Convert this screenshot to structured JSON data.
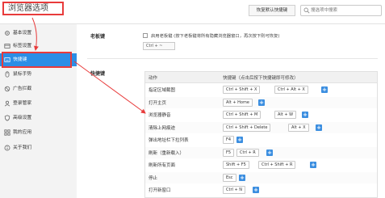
{
  "header": {
    "title": "浏览器选项",
    "restore_label": "恢复默认快捷键",
    "search_placeholder": "搜选项中搜索"
  },
  "sidebar": {
    "items": [
      {
        "label": "基本设置",
        "icon": "gear-icon"
      },
      {
        "label": "标签设置",
        "icon": "tab-icon"
      },
      {
        "label": "快捷键",
        "icon": "keyboard-icon",
        "active": true
      },
      {
        "label": "鼠标手势",
        "icon": "mouse-icon"
      },
      {
        "label": "广告拦截",
        "icon": "block-icon"
      },
      {
        "label": "登录管家",
        "icon": "user-icon"
      },
      {
        "label": "高级设置",
        "icon": "shield-icon"
      },
      {
        "label": "我的应用",
        "icon": "apps-icon"
      },
      {
        "label": "关于我们",
        "icon": "info-icon"
      }
    ]
  },
  "boss_key": {
    "section_label": "老板键",
    "checkbox_text": "启用老板键 (按下老板键将所有隐藏浏览器窗口，再次按下则可恢复)",
    "value": "Ctrl + ~"
  },
  "hotkeys": {
    "section_label": "快捷键",
    "col_action": "动作",
    "col_key": "快捷键（点击后按下快捷键即可修改）",
    "rows": [
      {
        "action": "指定区域截图",
        "keys": [
          "Ctrl + Shift + X",
          "Ctrl + Alt + X"
        ]
      },
      {
        "action": "打开主页",
        "keys": [
          "Alt + Home"
        ]
      },
      {
        "action": "浏览器静音",
        "keys": [
          "Ctrl + Shift + M",
          "Alt + W"
        ]
      },
      {
        "action": "清除上网痕迹",
        "keys": [
          "Ctrl + Shift + Delete",
          "Alt + X"
        ]
      },
      {
        "action": "弹出地址栏下拉列表",
        "keys": [
          "F4"
        ]
      },
      {
        "action": "刷新（重新载入）",
        "keys": [
          "F5",
          "Ctrl + R"
        ]
      },
      {
        "action": "刷新所有页面",
        "keys": [
          "Shift + F5",
          "Ctrl + Shift + R"
        ]
      },
      {
        "action": "停止",
        "keys": [
          "Esc"
        ]
      },
      {
        "action": "打开新窗口",
        "keys": [
          "Ctrl + N"
        ]
      }
    ]
  },
  "colors": {
    "accent": "#2b8ee6",
    "highlight": "#e83b3b"
  }
}
